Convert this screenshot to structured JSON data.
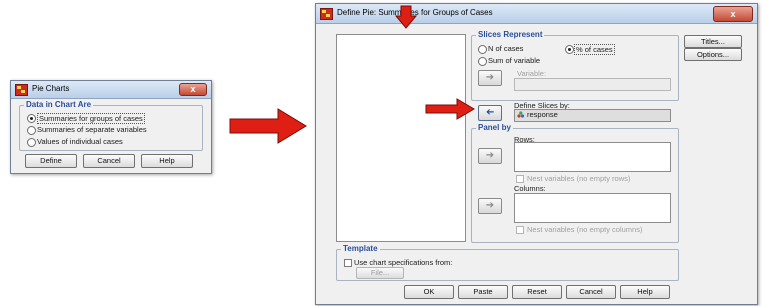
{
  "small_dialog": {
    "title": "Pie Charts",
    "group_label": "Data in Chart Are",
    "options": [
      {
        "label": "Summaries for groups of cases",
        "selected": true
      },
      {
        "label": "Summaries of separate variables",
        "selected": false
      },
      {
        "label": "Values of individual cases",
        "selected": false
      }
    ],
    "buttons": {
      "define": "Define",
      "cancel": "Cancel",
      "help": "Help"
    }
  },
  "main_dialog": {
    "title": "Define Pie: Summaries for Groups of Cases",
    "close_glyph": "x",
    "slices": {
      "label": "Slices Represent",
      "n_cases": "N of cases",
      "pct_cases": "% of cases",
      "sum_var": "Sum of variable",
      "variable_label": "Variable:",
      "selected": "pct_cases"
    },
    "define_slices": {
      "label": "Define Slices by:",
      "value": "response"
    },
    "panel": {
      "label": "Panel by",
      "rows_label": "Rows:",
      "nest_rows": "Nest variables (no empty rows)",
      "columns_label": "Columns:",
      "nest_columns": "Nest variables (no empty columns)"
    },
    "template": {
      "label": "Template",
      "use_chart": "Use chart specifications from:",
      "file_button": "File..."
    },
    "side_buttons": {
      "titles": "Titles...",
      "options": "Options..."
    },
    "bottom_buttons": {
      "ok": "OK",
      "paste": "Paste",
      "reset": "Reset",
      "cancel": "Cancel",
      "help": "Help"
    },
    "arrow_glyph": "➔"
  },
  "colors": {
    "annotation_arrow": "#e01f14",
    "group_label": "#2a4f9c"
  }
}
